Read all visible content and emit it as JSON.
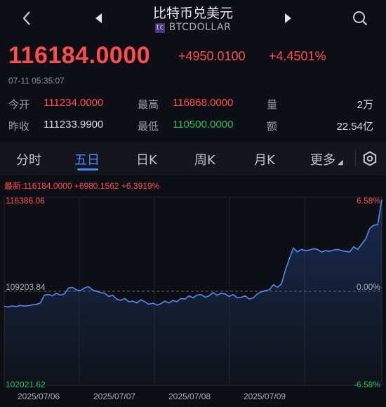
{
  "header": {
    "title": "比特币兑美元",
    "symbol": "BTCDOLLAR",
    "symbol_badge": "IC",
    "back_icon": "chevron-left-icon",
    "prev_icon": "triangle-left-icon",
    "next_icon": "triangle-right-icon",
    "search_icon": "search-icon"
  },
  "quote": {
    "price": "116184.0000",
    "change": "+4950.0100",
    "change_pct": "+4.4501%",
    "time": "07-11 05:35:07"
  },
  "stats": [
    {
      "label": "今开",
      "value": "111234.0000",
      "color": "#ff4d4f"
    },
    {
      "label": "最高",
      "value": "116868.0000",
      "color": "#ff4d4f"
    },
    {
      "label": "量",
      "value": "2万",
      "color": "#d7d9e0"
    },
    {
      "label": "昨收",
      "value": "111233.9900",
      "color": "#d7d9e0"
    },
    {
      "label": "最低",
      "value": "110500.0000",
      "color": "#20c05c"
    },
    {
      "label": "额",
      "value": "22.54亿",
      "color": "#d7d9e0"
    }
  ],
  "tabs": [
    {
      "label": "分时",
      "active": false
    },
    {
      "label": "五日",
      "active": true
    },
    {
      "label": "日K",
      "active": false
    },
    {
      "label": "周K",
      "active": false
    },
    {
      "label": "月K",
      "active": false
    },
    {
      "label": "更多",
      "active": false
    }
  ],
  "settings_icon": "settings-icon",
  "chart_data": {
    "type": "area",
    "latest_label": "最新:116184.0000  +6980.1562  +6.3919%",
    "y_labels_left": [
      "116386.06",
      "109203.84",
      "102021.62"
    ],
    "y_labels_right": [
      "6.58%",
      "0.00%",
      "-6.58%"
    ],
    "ylim": [
      102021.62,
      116386.06
    ],
    "baseline": 109203.84,
    "x_labels": [
      "2025/07/06",
      "2025/07/07",
      "2025/07/08",
      "2025/07/09"
    ],
    "series": [
      {
        "values": [
          108050,
          108000,
          108080,
          108030,
          108120,
          108070,
          108100,
          108160,
          108200,
          108300,
          108900,
          108950,
          108850,
          109050,
          108900,
          109000,
          109450,
          109500,
          109300,
          109250,
          109450,
          109550,
          109300,
          109200,
          109100,
          109050,
          108800,
          108900,
          108600,
          108500,
          108650,
          108400,
          108450,
          108300,
          108550,
          108400,
          108200,
          108300,
          108150,
          108250,
          108450,
          108300,
          108500,
          108400,
          108650,
          108600,
          108850,
          108700,
          108900,
          108950,
          108750,
          108850,
          109100,
          108900,
          109050,
          109000,
          108800,
          108950,
          108700,
          108750,
          108850,
          108600,
          108700,
          109000,
          109150,
          109250,
          109300,
          109700,
          109500,
          109750,
          110800,
          111700,
          112500,
          112200,
          112400,
          112300,
          112350,
          112450,
          112400,
          112200,
          112300,
          112250,
          112350,
          112400,
          112300,
          112250,
          112200,
          112600,
          112400,
          112800,
          113200,
          114000,
          114250,
          114300,
          116200
        ]
      }
    ]
  }
}
